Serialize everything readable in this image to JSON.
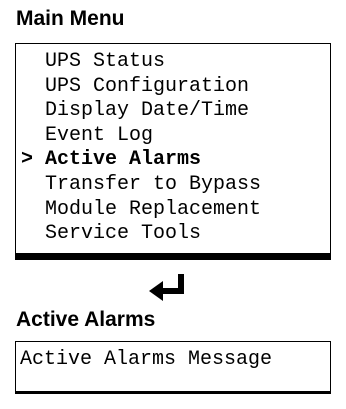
{
  "main_menu": {
    "title": "Main Menu",
    "cursor": ">",
    "items": [
      {
        "label": "UPS Status",
        "selected": false
      },
      {
        "label": "UPS Configuration",
        "selected": false
      },
      {
        "label": "Display Date/Time",
        "selected": false
      },
      {
        "label": "Event Log",
        "selected": false
      },
      {
        "label": "Active Alarms",
        "selected": true
      },
      {
        "label": "Transfer to Bypass",
        "selected": false
      },
      {
        "label": "Module Replacement",
        "selected": false
      },
      {
        "label": "Service Tools",
        "selected": false
      }
    ]
  },
  "transition_icon": "enter-arrow-icon",
  "active_alarms": {
    "title": "Active Alarms",
    "message": "Active Alarms Message"
  }
}
